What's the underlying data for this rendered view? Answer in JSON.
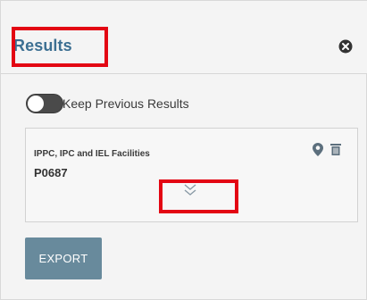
{
  "panel": {
    "title": "Results"
  },
  "toggle": {
    "label": "Keep Previous Results",
    "checked": false
  },
  "result_card": {
    "layer_name": "IPPC, IPC and IEL Facilities",
    "feature_id": "P0687"
  },
  "export": {
    "label": "EXPORT"
  },
  "colors": {
    "title": "#3c6f92",
    "highlight": "#e30613",
    "export_button": "#688a9c",
    "icon": "#5c6f7d"
  },
  "icons": {
    "close": "close-circle-icon",
    "zoom": "map-pin-icon",
    "remove": "trash-icon",
    "expand": "chevron-double-down-icon"
  }
}
